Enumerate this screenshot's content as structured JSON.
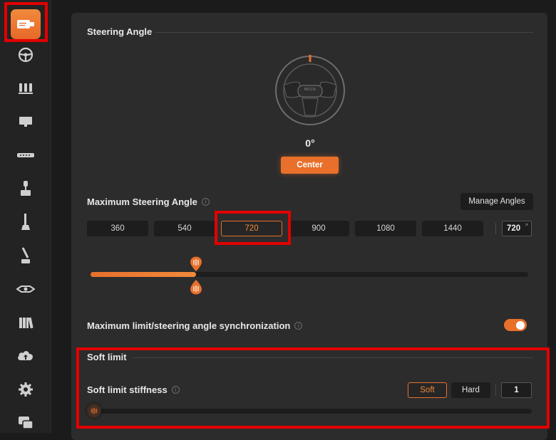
{
  "sidebar": {
    "items": [
      {
        "icon": "wheelbase-icon",
        "active": true
      },
      {
        "icon": "steering-wheel-icon"
      },
      {
        "icon": "pedals-icon"
      },
      {
        "icon": "dashboard-display-icon"
      },
      {
        "icon": "button-box-icon"
      },
      {
        "icon": "handbrake-icon"
      },
      {
        "icon": "shifter-icon"
      },
      {
        "icon": "sequential-shifter-icon"
      },
      {
        "icon": "hub-icon"
      },
      {
        "icon": "library-icon"
      },
      {
        "icon": "cloud-upload-icon"
      },
      {
        "icon": "settings-gear-icon"
      },
      {
        "icon": "support-chat-icon"
      }
    ]
  },
  "steering": {
    "title": "Steering Angle",
    "wheel_logo": "MOZA",
    "current_angle": "0°",
    "center_label": "Center"
  },
  "max_angle": {
    "label": "Maximum Steering Angle",
    "manage_label": "Manage Angles",
    "presets": [
      "360",
      "540",
      "720",
      "900",
      "1080",
      "1440"
    ],
    "selected": "720",
    "value": "720",
    "slider": {
      "min": 90,
      "max": 2700,
      "value": 720
    }
  },
  "sync": {
    "label": "Maximum limit/steering angle synchronization",
    "enabled": true
  },
  "soft_limit": {
    "title": "Soft limit",
    "stiffness_label": "Soft limit stiffness",
    "soft_label": "Soft",
    "hard_label": "Hard",
    "selected": "Soft",
    "value": "1",
    "slider": {
      "min": 1,
      "max": 10,
      "value": 1
    }
  },
  "colors": {
    "accent": "#e8702b",
    "panel": "#2c2c2c",
    "background": "#1b1b1b",
    "highlight": "#e30000"
  }
}
